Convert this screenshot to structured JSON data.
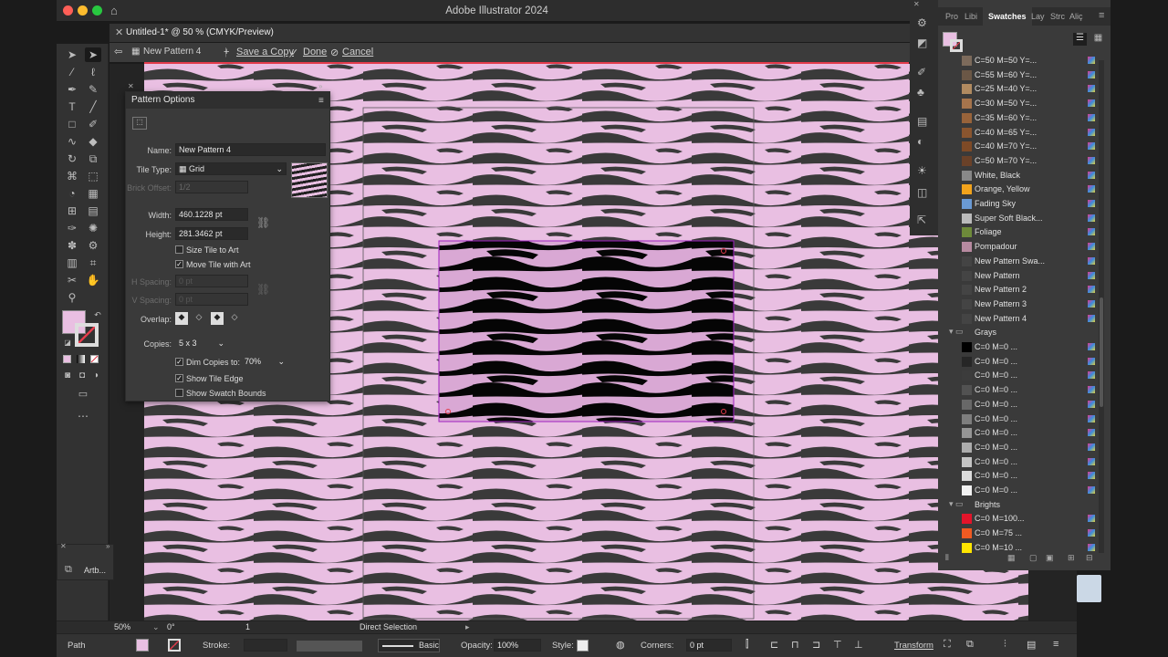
{
  "app": {
    "title": "Adobe Illustrator 2024"
  },
  "document_tab": {
    "label": "Untitled-1* @ 50 % (CMYK/Preview)"
  },
  "pattern_bar": {
    "pattern_name": "New Pattern 4",
    "save_copy": "Save a Copy",
    "done": "Done",
    "cancel": "Cancel"
  },
  "pattern_options": {
    "title": "Pattern Options",
    "name_label": "Name:",
    "name_value": "New Pattern 4",
    "tile_type_label": "Tile Type:",
    "tile_type_value": "Grid",
    "brick_offset_label": "Brick Offset:",
    "brick_offset_value": "1/2",
    "width_label": "Width:",
    "width_value": "460.1228 pt",
    "height_label": "Height:",
    "height_value": "281.3462 pt",
    "size_tile_to_art": "Size Tile to Art",
    "move_tile_with_art": "Move Tile with Art",
    "h_spacing_label": "H Spacing:",
    "h_spacing_value": "0 pt",
    "v_spacing_label": "V Spacing:",
    "v_spacing_value": "0 pt",
    "overlap_label": "Overlap:",
    "copies_label": "Copies:",
    "copies_value": "5 x 3",
    "dim_copies_label": "Dim Copies to:",
    "dim_copies_value": "70%",
    "show_tile_edge": "Show Tile Edge",
    "show_swatch_bounds": "Show Swatch Bounds"
  },
  "panel_tabs": [
    "Pro",
    "Libi",
    "Swatches",
    "Lay",
    "Strc",
    "Aliç"
  ],
  "swatches": [
    {
      "name": "C=50 M=50 Y=...",
      "color": "#7c6a5b"
    },
    {
      "name": "C=55 M=60 Y=...",
      "color": "#6b5746"
    },
    {
      "name": "C=25 M=40 Y=...",
      "color": "#b08a60"
    },
    {
      "name": "C=30 M=50 Y=...",
      "color": "#a6744c"
    },
    {
      "name": "C=35 M=60 Y=...",
      "color": "#98633a"
    },
    {
      "name": "C=40 M=65 Y=...",
      "color": "#8a552f"
    },
    {
      "name": "C=40 M=70 Y=...",
      "color": "#7e4a26"
    },
    {
      "name": "C=50 M=70 Y=...",
      "color": "#6a4128"
    },
    {
      "name": "White, Black",
      "color": "#888888"
    },
    {
      "name": "Orange, Yellow",
      "color": "#f2a31c"
    },
    {
      "name": "Fading Sky",
      "color": "#6a9ad4"
    },
    {
      "name": "Super Soft Black...",
      "color": "#bbbbbb"
    },
    {
      "name": "Foliage",
      "color": "#6e8a3a"
    },
    {
      "name": "Pompadour",
      "color": "#b78aa0"
    },
    {
      "name": "New Pattern Swa...",
      "color": "#444444"
    },
    {
      "name": "New Pattern",
      "color": "#444444"
    },
    {
      "name": "New Pattern 2",
      "color": "#444444"
    },
    {
      "name": "New Pattern 3",
      "color": "#444444"
    },
    {
      "name": "New Pattern 4",
      "color": "#444444"
    }
  ],
  "grays_group": {
    "label": "Grays"
  },
  "grays": [
    {
      "name": "C=0 M=0 ...",
      "color": "#000000"
    },
    {
      "name": "C=0 M=0 ...",
      "color": "#262626"
    },
    {
      "name": "C=0 M=0 ...",
      "color": "#3c3c3c"
    },
    {
      "name": "C=0 M=0 ...",
      "color": "#525252"
    },
    {
      "name": "C=0 M=0 ...",
      "color": "#686868"
    },
    {
      "name": "C=0 M=0 ...",
      "color": "#7e7e7e"
    },
    {
      "name": "C=0 M=0 ...",
      "color": "#959595"
    },
    {
      "name": "C=0 M=0 ...",
      "color": "#acacac"
    },
    {
      "name": "C=0 M=0 ...",
      "color": "#c4c4c4"
    },
    {
      "name": "C=0 M=0 ...",
      "color": "#dcdcdc"
    },
    {
      "name": "C=0 M=0 ...",
      "color": "#f2f2f2"
    }
  ],
  "brights_group": {
    "label": "Brights"
  },
  "brights": [
    {
      "name": "C=0 M=100...",
      "color": "#e3142a"
    },
    {
      "name": "C=0 M=75 ...",
      "color": "#f05a22"
    },
    {
      "name": "C=0 M=10 ...",
      "color": "#ffe500"
    }
  ],
  "status": {
    "zoom": "50%",
    "rotation": "0°",
    "artboard": "1",
    "tool": "Direct Selection"
  },
  "control": {
    "object": "Path",
    "stroke_label": "Stroke:",
    "brush": "Basic",
    "opacity_label": "Opacity:",
    "opacity_value": "100%",
    "style_label": "Style:",
    "corners_label": "Corners:",
    "corners_value": "0 pt",
    "transform": "Transform"
  },
  "mini_panel": {
    "label": "Artb..."
  },
  "colors": {
    "pink": "#e9bfe2",
    "stripe": "#3a3a3a",
    "accent": "#e33b4b",
    "selection": "#a01fc0"
  }
}
